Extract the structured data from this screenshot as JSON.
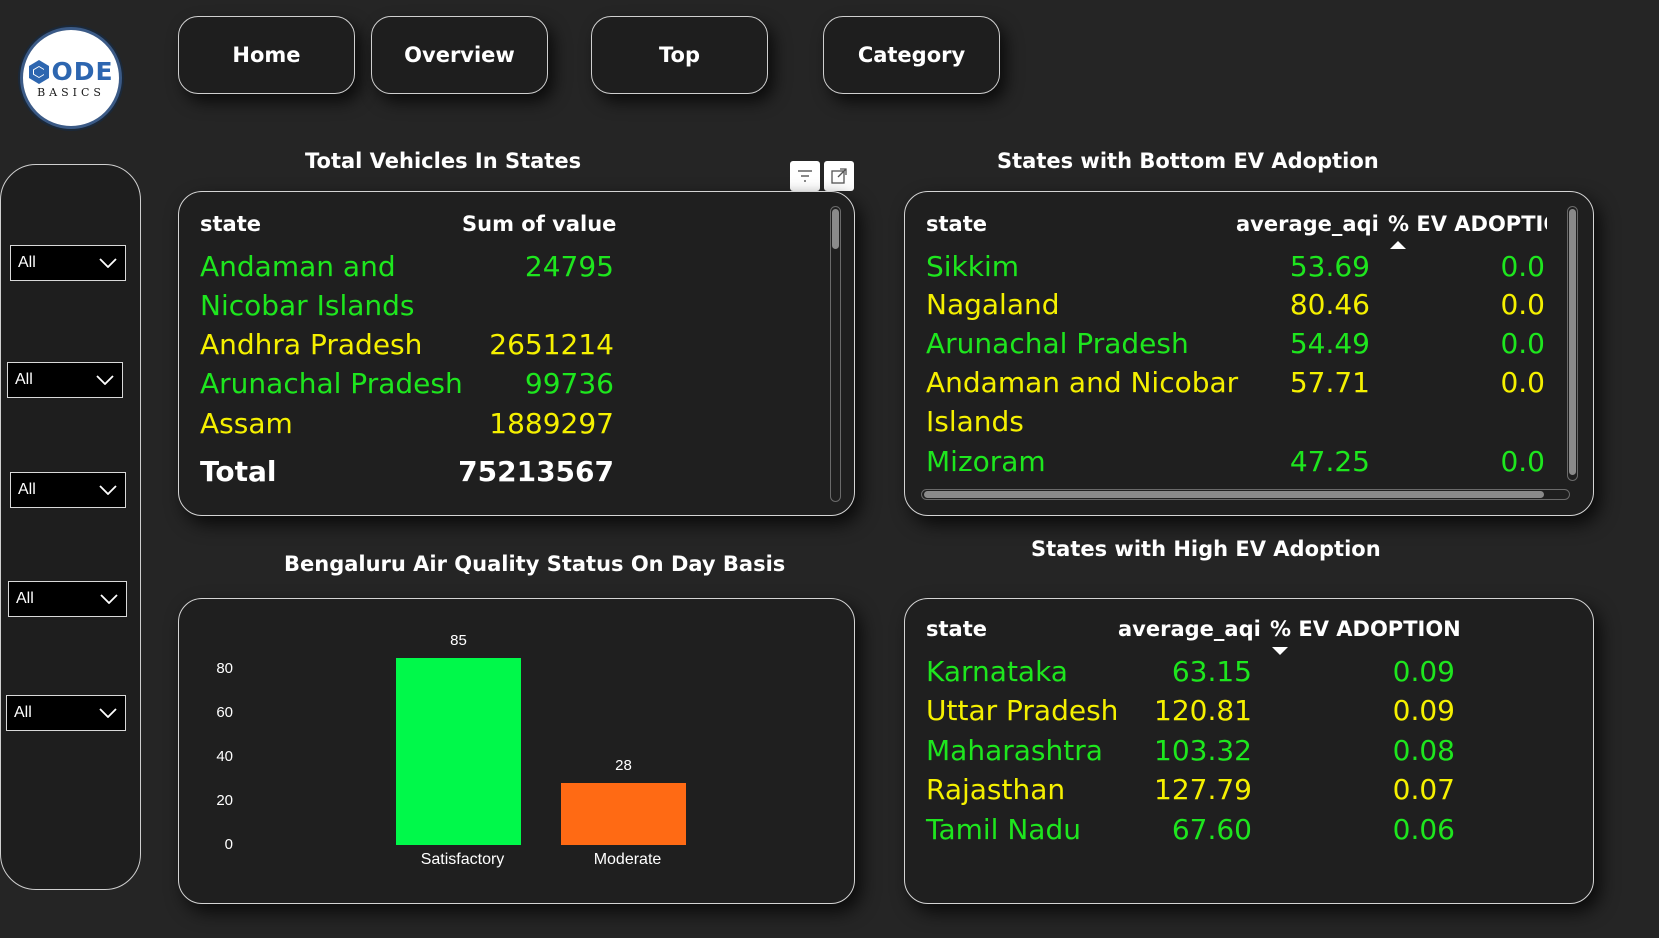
{
  "logo": {
    "main": "ODE",
    "sub": "BASICS",
    "brand_color": "#2d66b0"
  },
  "nav": {
    "home": "Home",
    "overview": "Overview",
    "top": "Top",
    "category": "Category"
  },
  "slicers": [
    "All",
    "All",
    "All",
    "All",
    "All"
  ],
  "total_vehicles": {
    "title": "Total Vehicles In States",
    "headers": {
      "state": "state",
      "value": "Sum of value"
    },
    "rows": [
      {
        "state_line1": "Andaman and",
        "state_line2": "Nicobar Islands",
        "value": "24795",
        "color": "#1ee61e"
      },
      {
        "state": "Andhra Pradesh",
        "value": "2651214",
        "color": "#f5f000"
      },
      {
        "state": "Arunachal Pradesh",
        "value": "99736",
        "color": "#1ee61e"
      },
      {
        "state": "Assam",
        "value": "1889297",
        "color": "#f5f000"
      }
    ],
    "total_label": "Total",
    "total_value": "75213567"
  },
  "bottom_ev": {
    "title": "States with Bottom EV Adoption",
    "headers": {
      "state": "state",
      "aqi": "average_aqi",
      "ev": "% EV ADOPTIOI"
    },
    "rows": [
      {
        "state": "Sikkim",
        "aqi": "53.69",
        "ev": "0.0",
        "color": "#1ee61e"
      },
      {
        "state": "Nagaland",
        "aqi": "80.46",
        "ev": "0.0",
        "color": "#f5f000"
      },
      {
        "state": "Arunachal Pradesh",
        "aqi": "54.49",
        "ev": "0.0",
        "color": "#1ee61e"
      },
      {
        "state_line1": "Andaman and Nicobar",
        "state_line2": "Islands",
        "aqi": "57.71",
        "ev": "0.0",
        "color": "#f5f000"
      },
      {
        "state": "Mizoram",
        "aqi": "47.25",
        "ev": "0.0",
        "color": "#1ee61e"
      }
    ]
  },
  "high_ev": {
    "title": "States with High EV Adoption",
    "headers": {
      "state": "state",
      "aqi": "average_aqi",
      "ev": "% EV ADOPTION"
    },
    "rows": [
      {
        "state": "Karnataka",
        "aqi": "63.15",
        "ev": "0.09",
        "color": "#1ee61e"
      },
      {
        "state": "Uttar Pradesh",
        "aqi": "120.81",
        "ev": "0.09",
        "color": "#f5f000"
      },
      {
        "state": "Maharashtra",
        "aqi": "103.32",
        "ev": "0.08",
        "color": "#1ee61e"
      },
      {
        "state": "Rajasthan",
        "aqi": "127.79",
        "ev": "0.07",
        "color": "#f5f000"
      },
      {
        "state": "Tamil Nadu",
        "aqi": "67.60",
        "ev": "0.06",
        "color": "#1ee61e"
      }
    ]
  },
  "aqi_chart": {
    "title": "Bengaluru Air Quality Status On Day Basis"
  },
  "chart_data": {
    "type": "bar",
    "categories": [
      "Satisfactory",
      "Moderate"
    ],
    "values": [
      85,
      28
    ],
    "colors": [
      "#00f94a",
      "#ff6a14"
    ],
    "data_labels": [
      "85",
      "28"
    ],
    "yticks": [
      "0",
      "20",
      "40",
      "60",
      "80"
    ],
    "ylim": [
      0,
      100
    ],
    "xlabel": "",
    "ylabel": "",
    "grid": false
  }
}
